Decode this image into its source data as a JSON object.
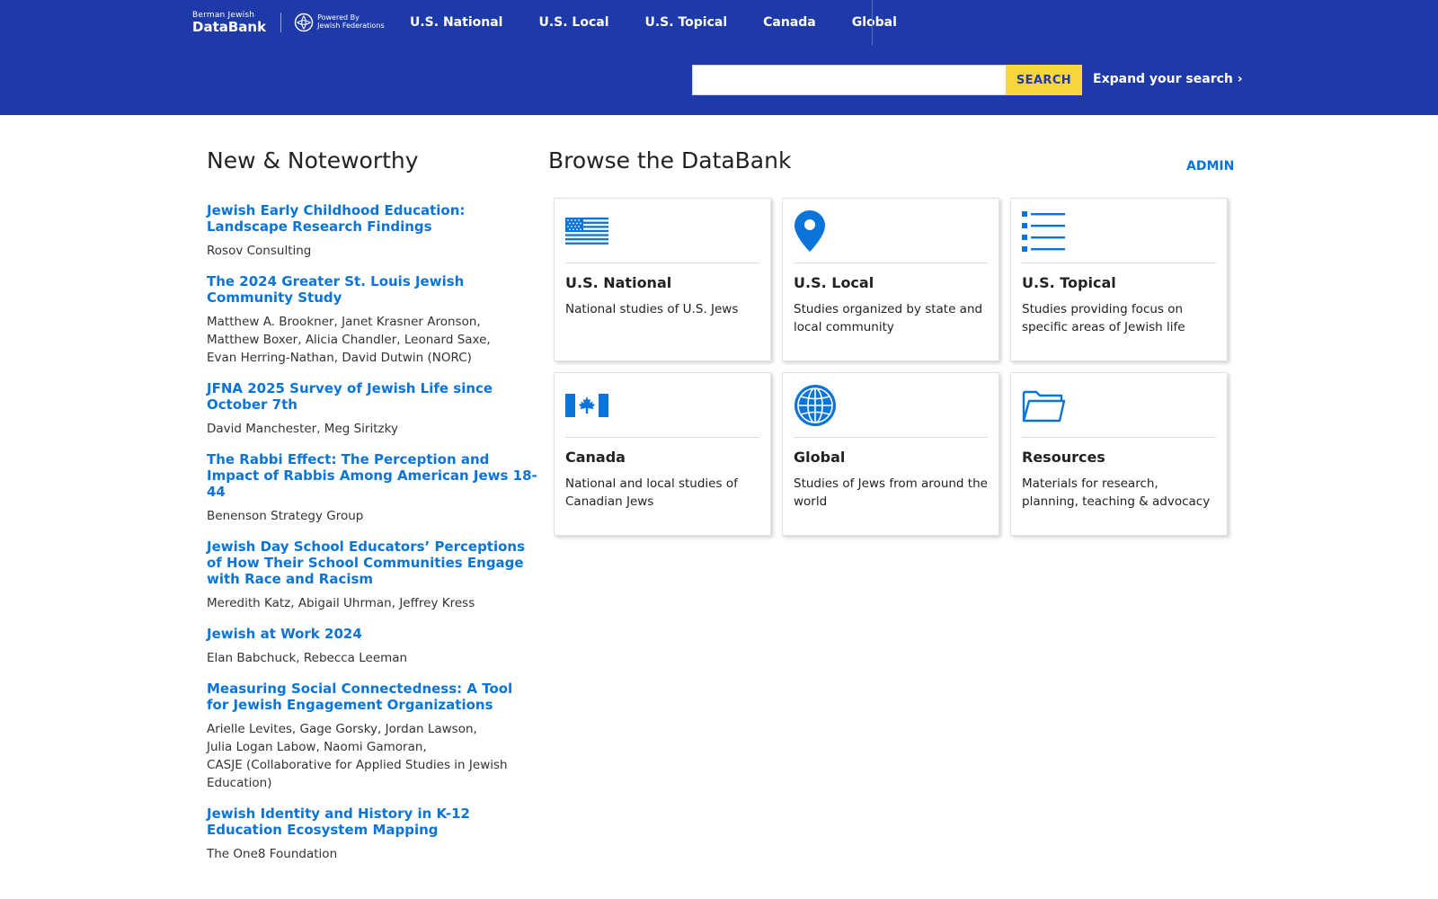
{
  "header": {
    "logo": {
      "line1": "Berman Jewish",
      "line2": "DataBank",
      "powered_by_line1": "Powered By",
      "powered_by_line2": "Jewish Federations"
    },
    "nav": [
      {
        "label": "U.S. National"
      },
      {
        "label": "U.S. Local"
      },
      {
        "label": "U.S. Topical"
      },
      {
        "label": "Canada"
      },
      {
        "label": "Global"
      }
    ],
    "search": {
      "value": "",
      "placeholder": "",
      "button_label": "SEARCH"
    },
    "expand_search": "Expand your search ›"
  },
  "colors": {
    "header_bg": "#1e3aa8",
    "search_button": "#f8d63c",
    "link": "#0a74d8",
    "icon": "#0a74d8"
  },
  "news": {
    "title": "New & Noteworthy",
    "items": [
      {
        "title": "Jewish Early Childhood Education: Landscape Research Findings",
        "authors": [
          "Rosov Consulting"
        ]
      },
      {
        "title": "The 2024 Greater St. Louis Jewish Community Study",
        "authors": [
          "Matthew A. Brookner, Janet Krasner Aronson,",
          "Matthew Boxer, Alicia Chandler, Leonard Saxe,",
          "Evan Herring-Nathan, David Dutwin (NORC)"
        ]
      },
      {
        "title": "JFNA 2025 Survey of Jewish Life since October 7th",
        "authors": [
          "David Manchester, Meg Siritzky"
        ]
      },
      {
        "title": "The Rabbi Effect: The Perception and Impact of Rabbis Among American Jews 18-44",
        "authors": [
          "Benenson Strategy Group"
        ]
      },
      {
        "title": "Jewish Day School Educators’ Perceptions of How Their School Communities Engage with Race and Racism",
        "authors": [
          "Meredith Katz, Abigail Uhrman, Jeffrey Kress"
        ]
      },
      {
        "title": "Jewish at Work 2024",
        "authors": [
          "Elan Babchuck, Rebecca Leeman"
        ]
      },
      {
        "title": "Measuring Social Connectedness: A Tool for Jewish Engagement Organizations",
        "authors": [
          "Arielle Levites, Gage Gorsky, Jordan Lawson,",
          "Julia Logan Labow, Naomi Gamoran,",
          "CASJE (Collaborative for Applied Studies in Jewish Education)"
        ]
      },
      {
        "title": "Jewish Identity and History in K-12 Education Ecosystem Mapping",
        "authors": [
          "The One8 Foundation"
        ]
      }
    ]
  },
  "browse": {
    "title": "Browse the DataBank",
    "admin_label": "ADMIN",
    "cards": [
      {
        "icon": "us-flag-icon",
        "title": "U.S. National",
        "desc": "National studies of U.S. Jews"
      },
      {
        "icon": "map-pin-icon",
        "title": "U.S. Local",
        "desc": "Studies organized by state and local community"
      },
      {
        "icon": "list-icon",
        "title": "U.S. Topical",
        "desc": "Studies providing focus on specific areas of Jewish life"
      },
      {
        "icon": "canada-flag-icon",
        "title": "Canada",
        "desc": "National and local studies of Canadian Jews"
      },
      {
        "icon": "globe-icon",
        "title": "Global",
        "desc": "Studies of Jews from around the world"
      },
      {
        "icon": "folder-icon",
        "title": "Resources",
        "desc": "Materials for research, planning, teaching & advocacy"
      }
    ]
  }
}
